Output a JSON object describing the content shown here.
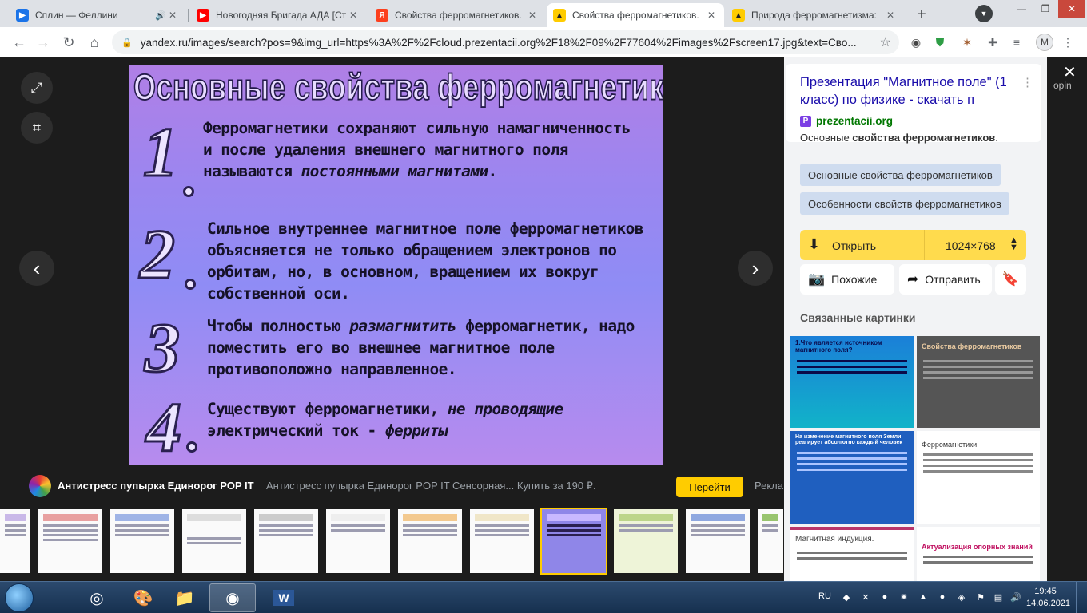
{
  "tabs": [
    {
      "title": "Сплин — Феллини",
      "favicon": "media-icon",
      "color": "#1a73e8",
      "audio": true
    },
    {
      "title": "Новогодняя Бригада АДА [Ст",
      "favicon": "youtube-icon",
      "color": "#ff0000"
    },
    {
      "title": "Свойства ферромагнетиков.",
      "favicon": "yandex-icon",
      "color": "#fc3f1d"
    },
    {
      "title": "Свойства ферромагнетиков.",
      "favicon": "yandex-images-icon",
      "color": "#ffcc00",
      "active": true
    },
    {
      "title": "Природа ферромагнетизма:",
      "favicon": "yandex-images-icon",
      "color": "#ffcc00"
    }
  ],
  "toolbar": {
    "url": "yandex.ru/images/search?pos=9&img_url=https%3A%2F%2Fcloud.prezentacii.org%2F18%2F09%2F77604%2Fimages%2Fscreen17.jpg&text=Сво...",
    "profile_initial": "M"
  },
  "slide": {
    "title": "Основные свойства ферромагнетиков:",
    "items": [
      {
        "num": "1",
        "text_parts": [
          "Ферромагнетики сохраняют сильную намагниченность и после удаления внешнего магнитного поля  называются ",
          "постоянными магнитами",
          "."
        ]
      },
      {
        "num": "2",
        "text_parts": [
          "Сильное внутреннее магнитное поле ферромагнетиков объясняется не только обращением электронов по орбитам, но, в основном, вращением их вокруг собственной оси."
        ]
      },
      {
        "num": "3",
        "text_parts": [
          "Чтобы полностью ",
          "размагнитить",
          " ферромагнетик, надо поместить его во внешнее магнитное поле противоположно направленное."
        ]
      },
      {
        "num": "4",
        "text_parts": [
          "Существуют ферромагнетики, ",
          "не проводящие",
          " электрический ток - ",
          "ферриты",
          ""
        ]
      }
    ]
  },
  "ad": {
    "title": "Антистресс пупырка Единорог POP IT",
    "description": "Антистресс пупырка Единорог POP IT Сенсорная... Купить за 190 ₽.",
    "button": "Перейти",
    "trailing": "Рекла"
  },
  "panel": {
    "card_title": "Презентация \"Магнитное поле\" (1 класс) по физике - скачать п",
    "site": "prezentacii.org",
    "desc_plain": "Основные ",
    "desc_bold": "свойства ферромагнетиков",
    "desc_end": ".",
    "tags": [
      "Основные свойства ферромагнетиков",
      "Особенности свойств ферромагнетиков"
    ],
    "open_label": "Открыть",
    "size_label": "1024×768",
    "similar_label": "Похожие",
    "share_label": "Отправить",
    "related_heading": "Связанные картинки"
  },
  "related": [
    {
      "title": "1.Что является источником магнитного поля?",
      "bg": "#1a6fd4"
    },
    {
      "title": "Свойства ферромагнетиков",
      "bg": "#555555"
    },
    {
      "title": "На изменение магнитного поля Земли реагирует абсолютно каждый человек",
      "bg": "#1f5fbf"
    },
    {
      "title": "Ферромагнетики",
      "bg": "#ffffff"
    },
    {
      "title": "Магнитная индукция.",
      "bg": "#b8356b"
    },
    {
      "title": "Актуализация опорных знаний",
      "bg": "#ffffff"
    }
  ],
  "edge_text": "opin",
  "taskbar": {
    "lang": "RU",
    "time": "19:45",
    "date": "14.06.2021"
  }
}
